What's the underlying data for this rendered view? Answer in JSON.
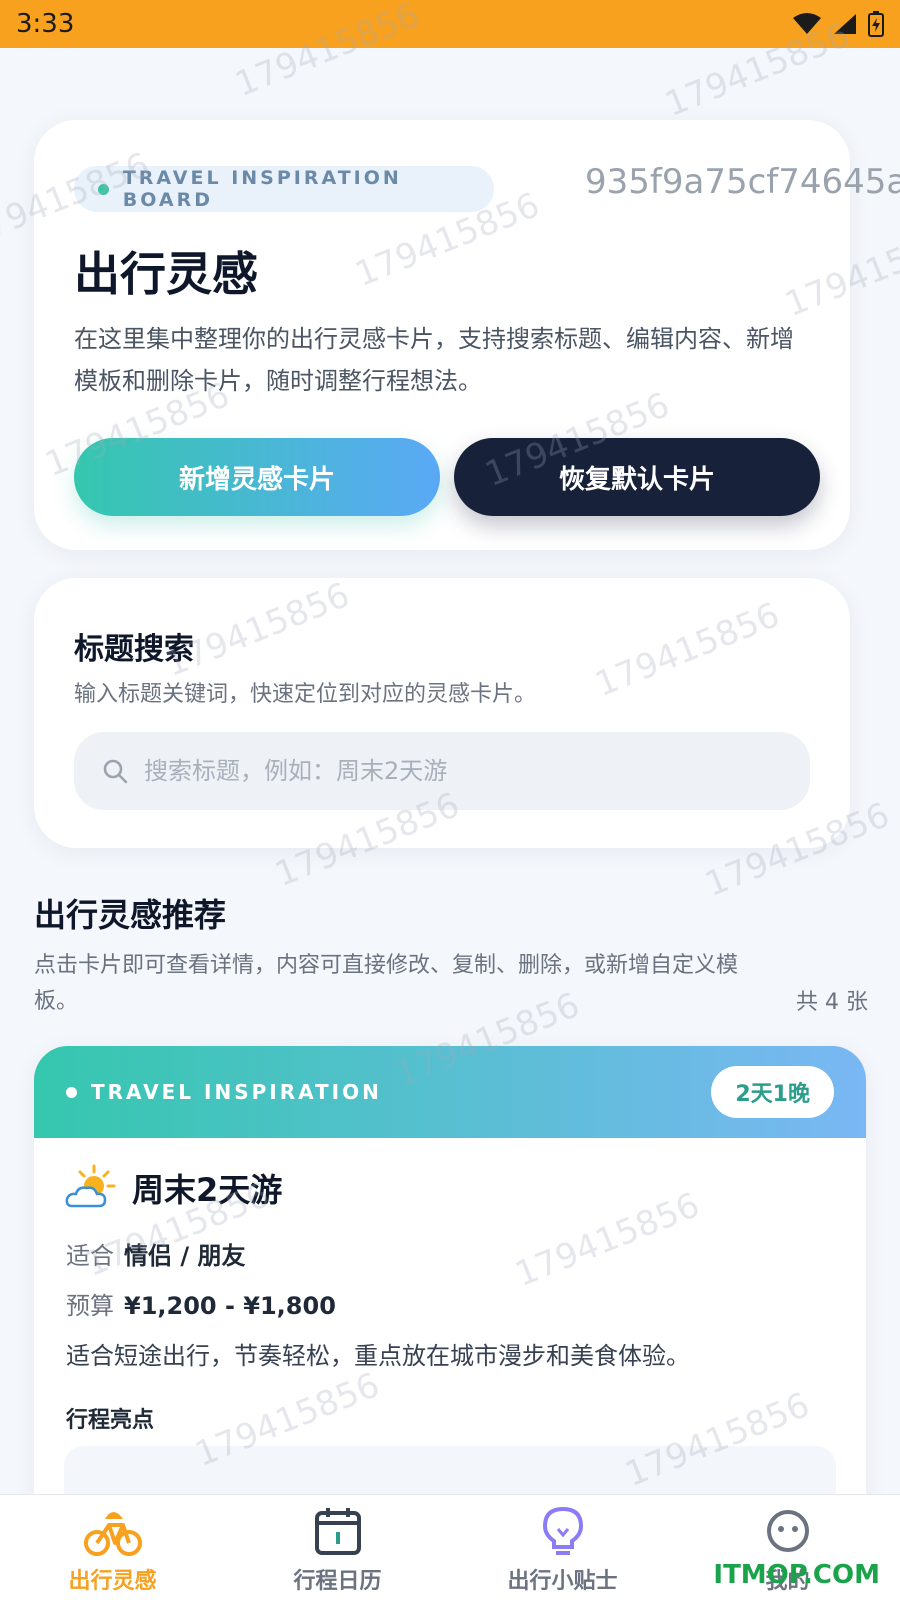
{
  "status_bar": {
    "time": "3:33"
  },
  "hero": {
    "badge": "TRAVEL INSPIRATION BOARD",
    "title": "出行灵感",
    "description": "在这里集中整理你的出行灵感卡片，支持搜索标题、编辑内容、新增模板和删除卡片，随时调整行程想法。",
    "add_button": "新增灵感卡片",
    "reset_button": "恢复默认卡片"
  },
  "search": {
    "title": "标题搜索",
    "description": "输入标题关键词，快速定位到对应的灵感卡片。",
    "placeholder": "搜索标题，例如：周末2天游"
  },
  "section": {
    "title": "出行灵感推荐",
    "description": "点击卡片即可查看详情，内容可直接修改、复制、删除，或新增自定义模板。",
    "count": "共 4 张"
  },
  "trip": {
    "header_label": "TRAVEL INSPIRATION",
    "duration": "2天1晚",
    "title": "周末2天游",
    "suitable_label": "适合",
    "suitable_value": "情侣 / 朋友",
    "budget_label": "预算",
    "budget_value": "¥1,200 - ¥1,800",
    "description": "适合短途出行，节奏轻松，重点放在城市漫步和美食体验。",
    "highlight_label": "行程亮点"
  },
  "nav": [
    {
      "label": "出行灵感",
      "icon": "bicycle-icon",
      "active": true
    },
    {
      "label": "行程日历",
      "icon": "calendar-icon",
      "active": false
    },
    {
      "label": "出行小贴士",
      "icon": "lightbulb-icon",
      "active": false
    },
    {
      "label": "我的",
      "icon": "smiley-icon",
      "active": false
    }
  ],
  "watermarks": {
    "number": "179415856",
    "hash": "935f9a75cf74645a",
    "site": "ITMOP.COM"
  },
  "colors": {
    "status_bar": "#f7a11e",
    "accent_green": "#35c7ae",
    "accent_blue": "#5aa9f6",
    "dark_button": "#18213a",
    "nav_active": "#f7a11e"
  }
}
